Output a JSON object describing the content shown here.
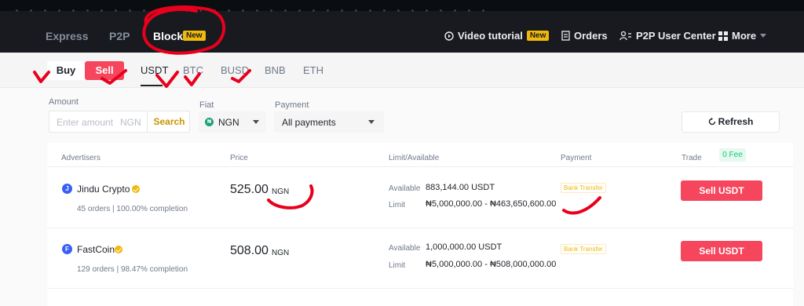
{
  "topnav": {
    "express": "Express",
    "p2p": "P2P",
    "block": "Block",
    "block_badge": "New",
    "video_tutorial": "Video tutorial",
    "video_badge": "New",
    "orders": "Orders",
    "user_center": "P2P User Center",
    "more": "More"
  },
  "subnav": {
    "buy": "Buy",
    "sell": "Sell",
    "assets": [
      "USDT",
      "BTC",
      "BUSD",
      "BNB",
      "ETH"
    ]
  },
  "filters": {
    "amount_label": "Amount",
    "amount_placeholder": "Enter amount",
    "amount_currency": "NGN",
    "search": "Search",
    "fiat_label": "Fiat",
    "fiat_value": "NGN",
    "payment_label": "Payment",
    "payment_value": "All payments",
    "refresh": "Refresh"
  },
  "table": {
    "headers": {
      "advertisers": "Advertisers",
      "price": "Price",
      "limit": "Limit/Available",
      "payment": "Payment",
      "trade": "Trade",
      "fee_badge": "0 Fee"
    },
    "rows": [
      {
        "initial": "J",
        "name": "Jindu Crypto",
        "orders": "45 orders",
        "completion": "100.00% completion",
        "price": "525.00",
        "price_currency": "NGN",
        "available_label": "Available",
        "available": "883,144.00 USDT",
        "limit_label": "Limit",
        "limit": "₦5,000,000.00 - ₦463,650,600.00",
        "payment": "Bank Transfer",
        "action": "Sell USDT"
      },
      {
        "initial": "F",
        "name": "FastCoin",
        "orders": "129 orders",
        "completion": "98.47% completion",
        "price": "508.00",
        "price_currency": "NGN",
        "available_label": "Available",
        "available": "1,000,000.00 USDT",
        "limit_label": "Limit",
        "limit": "₦5,000,000.00 - ₦508,000,000.00",
        "payment": "Bank Transfer",
        "action": "Sell USDT"
      }
    ]
  },
  "colors": {
    "brand": "#f0b90b",
    "sell": "#f6465d",
    "annotation": "#e8001c"
  }
}
